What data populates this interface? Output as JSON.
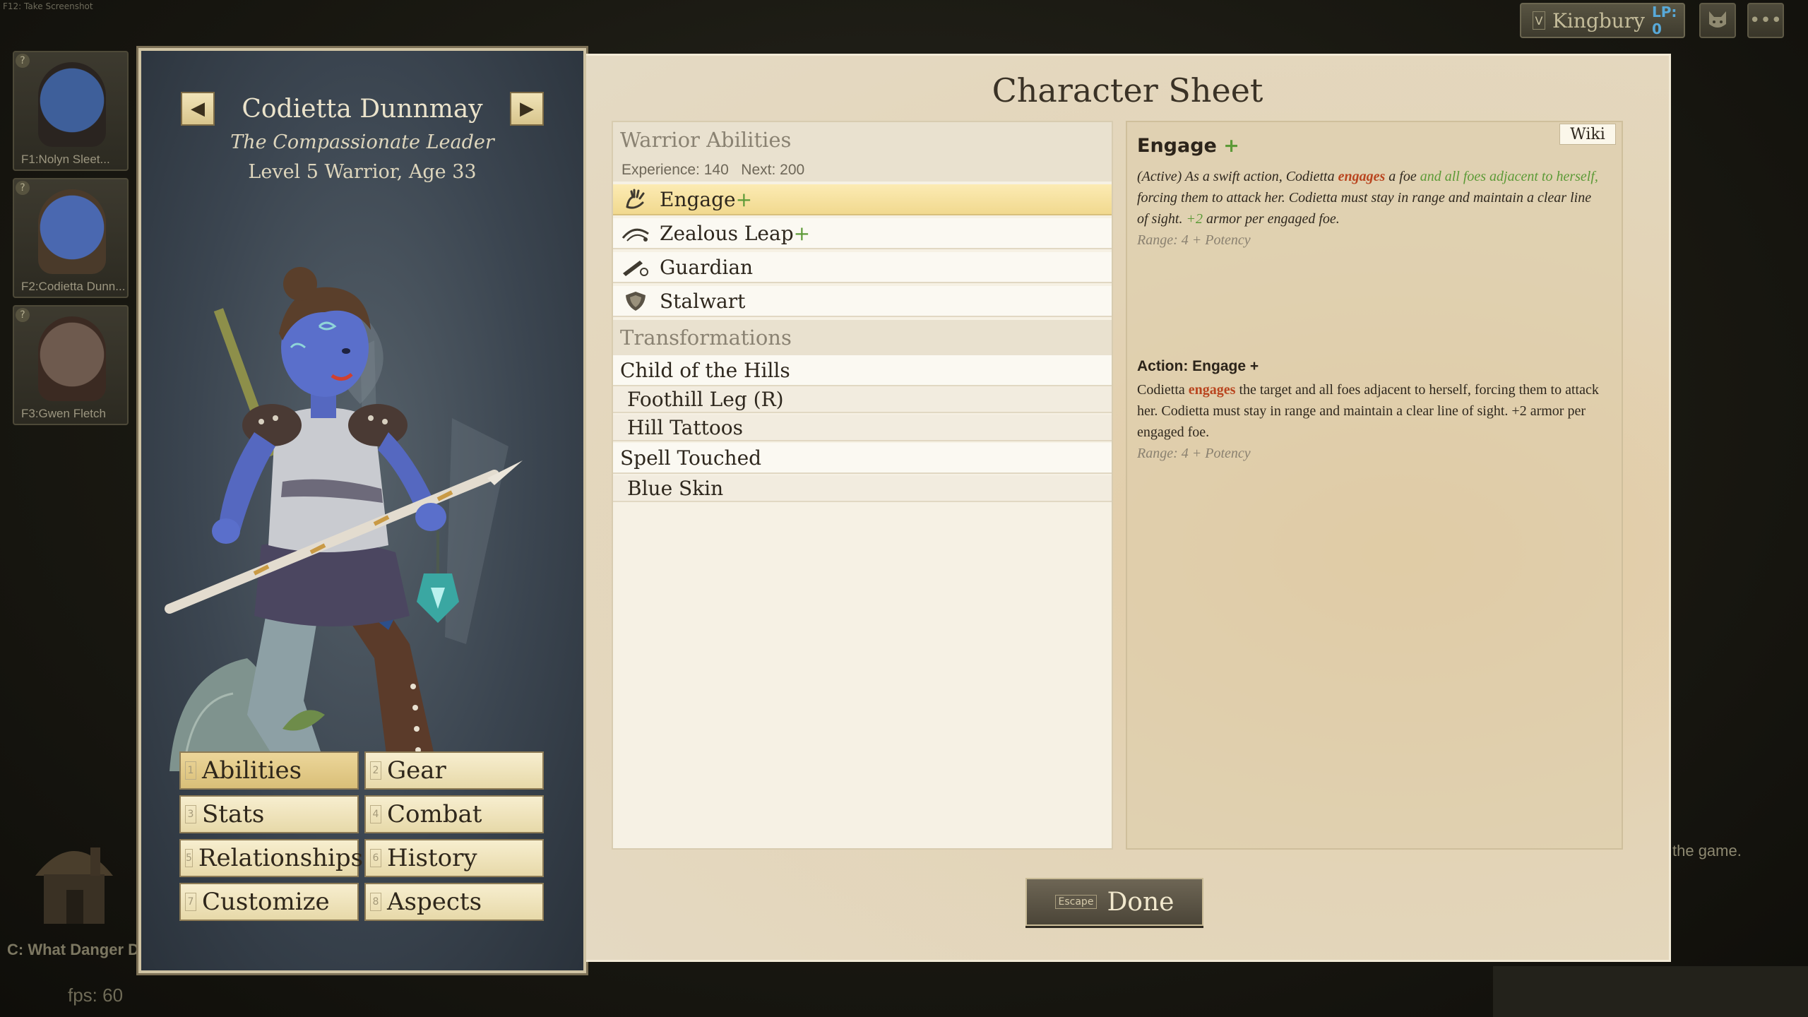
{
  "top_hint": "F12: Take Screenshot",
  "town": {
    "key": "V",
    "name": "Kingbury",
    "lp": "LP: 0"
  },
  "party": [
    {
      "label": "F1:Nolyn Sleet...",
      "skin": "#3e5f9a",
      "hair": "#2a2420"
    },
    {
      "label": "F2:Codietta Dunn...",
      "skin": "#4a68b0",
      "hair": "#4a3a2a"
    },
    {
      "label": "F3:Gwen Fletch",
      "skin": "#6e5a4e",
      "hair": "#3b2a22"
    }
  ],
  "quest": "C: What Danger D",
  "fps": "fps: 60",
  "side_text": "the game.",
  "character": {
    "name": "Codietta Dunnmay",
    "title": "The Compassionate Leader",
    "level_line": "Level 5 Warrior, Age 33"
  },
  "menu": [
    {
      "key": "1",
      "label": "Abilities",
      "active": true
    },
    {
      "key": "2",
      "label": "Gear"
    },
    {
      "key": "3",
      "label": "Stats"
    },
    {
      "key": "4",
      "label": "Combat"
    },
    {
      "key": "5",
      "label": "Relationships"
    },
    {
      "key": "6",
      "label": "History"
    },
    {
      "key": "7",
      "label": "Customize"
    },
    {
      "key": "8",
      "label": "Aspects"
    }
  ],
  "sheet": {
    "title": "Character Sheet",
    "abilities_heading": "Warrior Abilities",
    "experience": "Experience: 140",
    "next": "Next: 200",
    "abilities": [
      {
        "name": "Engage",
        "plus": "+",
        "icon": "hand-icon",
        "selected": true
      },
      {
        "name": "Zealous Leap",
        "plus": "+",
        "icon": "leap-icon"
      },
      {
        "name": "Guardian",
        "plus": "",
        "icon": "guardian-icon"
      },
      {
        "name": "Stalwart",
        "plus": "",
        "icon": "shield-icon"
      }
    ],
    "transformations_heading": "Transformations",
    "transformations": [
      {
        "name": "Child of the Hills"
      },
      {
        "name": "Foothill Leg (R)",
        "sub": true
      },
      {
        "name": "Hill Tattoos",
        "sub": true
      },
      {
        "name": "Spell Touched"
      },
      {
        "name": "Blue Skin",
        "sub": true
      }
    ]
  },
  "detail": {
    "wiki": "Wiki",
    "title": "Engage",
    "title_plus": "+",
    "desc": {
      "p1": "(Active) As a swift action, Codietta ",
      "kw1": "engages",
      "p2": " a foe ",
      "green": "and all foes adjacent to herself,",
      "p3": " forcing them to attack her. Codietta must stay in range and maintain a clear line of sight. ",
      "green2": "+2",
      "p4": " armor per engaged foe."
    },
    "range1": "Range: 4 + Potency",
    "action_title": "Action: Engage +",
    "action": {
      "p1": "Codietta ",
      "kw": "engages",
      "p2": " the target and all foes adjacent to herself, forcing them to attack her. Codietta must stay in range and maintain a clear line of sight. +2 armor per engaged foe."
    },
    "range2": "Range: 4 + Potency"
  },
  "done": {
    "key": "Escape",
    "label": "Done"
  }
}
